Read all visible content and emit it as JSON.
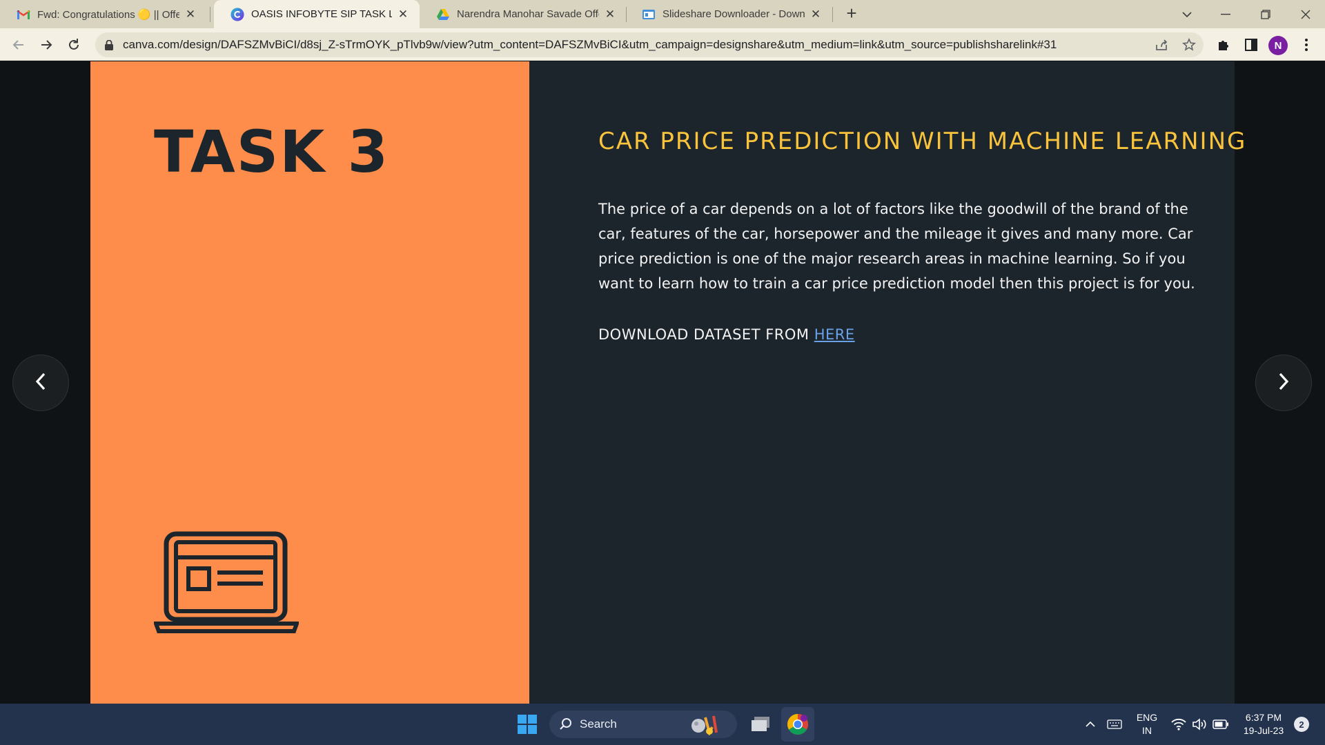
{
  "browser": {
    "tabs": [
      {
        "title": "Fwd: Congratulations 🟡 || Offer Letter",
        "icon": "gmail-icon",
        "active": false
      },
      {
        "title": "OASIS INFOBYTE SIP TASK LIST",
        "icon": "canva-icon",
        "active": true
      },
      {
        "title": "Narendra Manohar Savade Offer Letter",
        "icon": "google-drive-icon",
        "active": false
      },
      {
        "title": "Slideshare Downloader - Download",
        "icon": "slideshare-downloader-icon",
        "active": false
      }
    ],
    "url": "canva.com/design/DAFSZMvBiCI/d8sj_Z-sTrmOYK_pTlvb9w/view?utm_content=DAFSZMvBiCI&utm_campaign=designshare&utm_medium=link&utm_source=publishsharelink#31",
    "profile_initial": "N"
  },
  "slide": {
    "task_title": "TASK 3",
    "heading": "CAR PRICE PREDICTION WITH MACHINE LEARNING",
    "body": "The price of a car depends on a lot of factors like the goodwill of the brand of the car, features of the car, horsepower and the mileage it gives and many more. Car price prediction is one of the major research areas in machine learning. So if you want to learn how to train a car price prediction model then this project is for you.",
    "download_prefix": "DOWNLOAD DATASET FROM ",
    "download_link": "HERE",
    "colors": {
      "left_panel": "#fe8c4a",
      "right_panel": "#1c242c",
      "heading": "#f9c33c",
      "link": "#6aa2e8"
    }
  },
  "taskbar": {
    "search_label": "Search",
    "language_top": "ENG",
    "language_bottom": "IN",
    "time": "6:37 PM",
    "date": "19-Jul-23",
    "notification_count": "2"
  }
}
